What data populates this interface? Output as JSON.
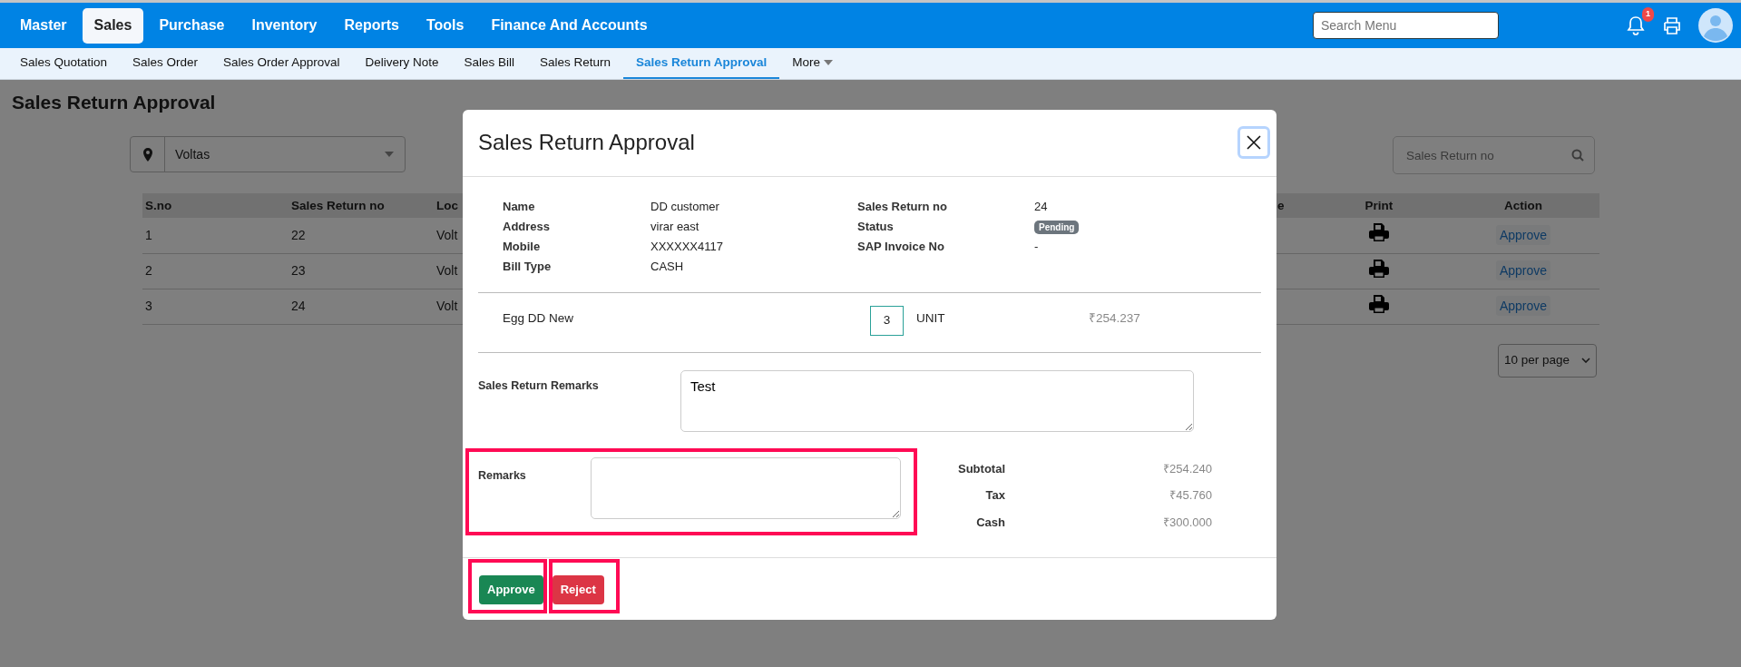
{
  "top_nav": {
    "items": [
      {
        "label": "Master",
        "selected": false
      },
      {
        "label": "Sales",
        "selected": true
      },
      {
        "label": "Purchase",
        "selected": false
      },
      {
        "label": "Inventory",
        "selected": false
      },
      {
        "label": "Reports",
        "selected": false
      },
      {
        "label": "Tools",
        "selected": false
      },
      {
        "label": "Finance And Accounts",
        "selected": false
      }
    ],
    "search": {
      "placeholder": "Search Menu"
    },
    "notification_count": "1"
  },
  "sub_nav": {
    "items": [
      {
        "label": "Sales Quotation",
        "selected": false,
        "kind": "link"
      },
      {
        "label": "Sales Order",
        "selected": false,
        "kind": "link"
      },
      {
        "label": "Sales Order Approval",
        "selected": false,
        "kind": "link"
      },
      {
        "label": "Delivery Note",
        "selected": false,
        "kind": "link"
      },
      {
        "label": "Sales Bill",
        "selected": false,
        "kind": "link"
      },
      {
        "label": "Sales Return",
        "selected": false,
        "kind": "link"
      },
      {
        "label": "Sales Return Approval",
        "selected": true,
        "kind": "link"
      },
      {
        "label": "More",
        "selected": false,
        "kind": "dropdown"
      }
    ]
  },
  "page_title": "Sales Return Approval",
  "filter": {
    "location": "Voltas"
  },
  "search": {
    "placeholder": "Sales Return no"
  },
  "table": {
    "columns": [
      "S.no",
      "Sales Return no",
      "Loc",
      "e",
      "Print",
      "Action"
    ],
    "rows": [
      {
        "cells": [
          "1",
          "22",
          "Volt"
        ],
        "action": "Approve"
      },
      {
        "cells": [
          "2",
          "23",
          "Volt"
        ],
        "action": "Approve"
      },
      {
        "cells": [
          "3",
          "24",
          "Volt"
        ],
        "action": "Approve"
      }
    ]
  },
  "pagination": {
    "per_page": "10 per page"
  },
  "modal": {
    "title": "Sales Return Approval",
    "details_left": [
      {
        "label": "Name",
        "value": "DD customer"
      },
      {
        "label": "Address",
        "value": "virar east"
      },
      {
        "label": "Mobile",
        "value": "XXXXXX4117"
      },
      {
        "label": "Bill Type",
        "value": "CASH"
      }
    ],
    "details_right": [
      {
        "label": "Sales Return no",
        "value": "24",
        "kind": "text"
      },
      {
        "label": "Status",
        "value": "Pending",
        "kind": "badge"
      },
      {
        "label": "SAP Invoice No",
        "value": "-",
        "kind": "text"
      }
    ],
    "items": [
      {
        "name": "Egg DD New",
        "quantity": "3",
        "unit": "UNIT",
        "price": "₹254.237"
      }
    ],
    "sales_return_remarks": {
      "label": "Sales Return Remarks",
      "value": "Test"
    },
    "remarks": {
      "label": "Remarks",
      "highlighted": true
    },
    "totals": [
      {
        "label": "Subtotal",
        "value": "₹254.240"
      },
      {
        "label": "Tax",
        "value": "₹45.760"
      },
      {
        "label": "Cash",
        "value": "₹300.000"
      }
    ],
    "buttons": [
      {
        "label": "Approve",
        "kind": "approve",
        "highlighted": true
      },
      {
        "label": "Reject",
        "kind": "reject",
        "highlighted": true
      }
    ]
  }
}
